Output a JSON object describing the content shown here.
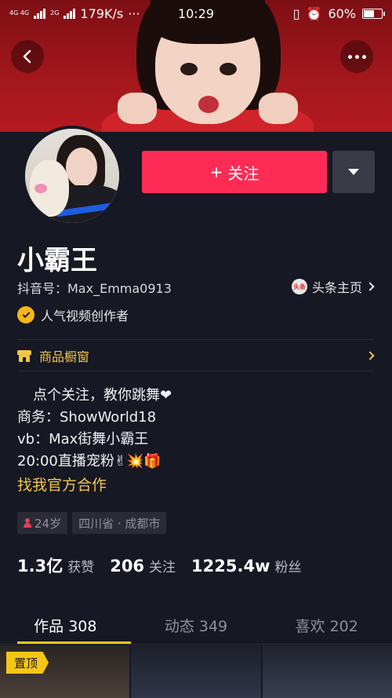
{
  "status_bar": {
    "network_top": "4G 4G",
    "network_bottom": "2G",
    "speed": "179K/s",
    "more": "···",
    "time": "10:29",
    "battery": "60%",
    "battery_level": 0.6
  },
  "profile": {
    "nickname": "小霸王",
    "douyin_id": "抖音号：Max_Emma0913",
    "toutiao_logo": "头条",
    "toutiao_link": "头条主页",
    "creator_tag": "人气视频创作者",
    "follow_button": "关注",
    "shop_window": "商品橱窗",
    "bio_lines": [
      "点个关注，教你跳舞❤",
      "商务：ShowWorld18",
      "vb：Max街舞小霸王",
      "20:00直播宠粉✌💥🎁"
    ],
    "coop_link": "找我官方合作",
    "age_tag": "24岁",
    "location_tag": "四川省 · 成都市",
    "stats": {
      "likes_num": "1.3亿",
      "likes_label": "获赞",
      "following_num": "206",
      "following_label": "关注",
      "fans_num": "1225.4w",
      "fans_label": "粉丝"
    }
  },
  "tabs": [
    {
      "label": "作品 308",
      "active": true
    },
    {
      "label": "动态 349",
      "active": false
    },
    {
      "label": "喜欢 202",
      "active": false
    }
  ],
  "grid": {
    "pinned_label": "置顶"
  },
  "colors": {
    "background": "#161823",
    "follow_red": "#fe2c55",
    "accent_yellow": "#f5c518",
    "link_yellow": "#f1c548"
  }
}
